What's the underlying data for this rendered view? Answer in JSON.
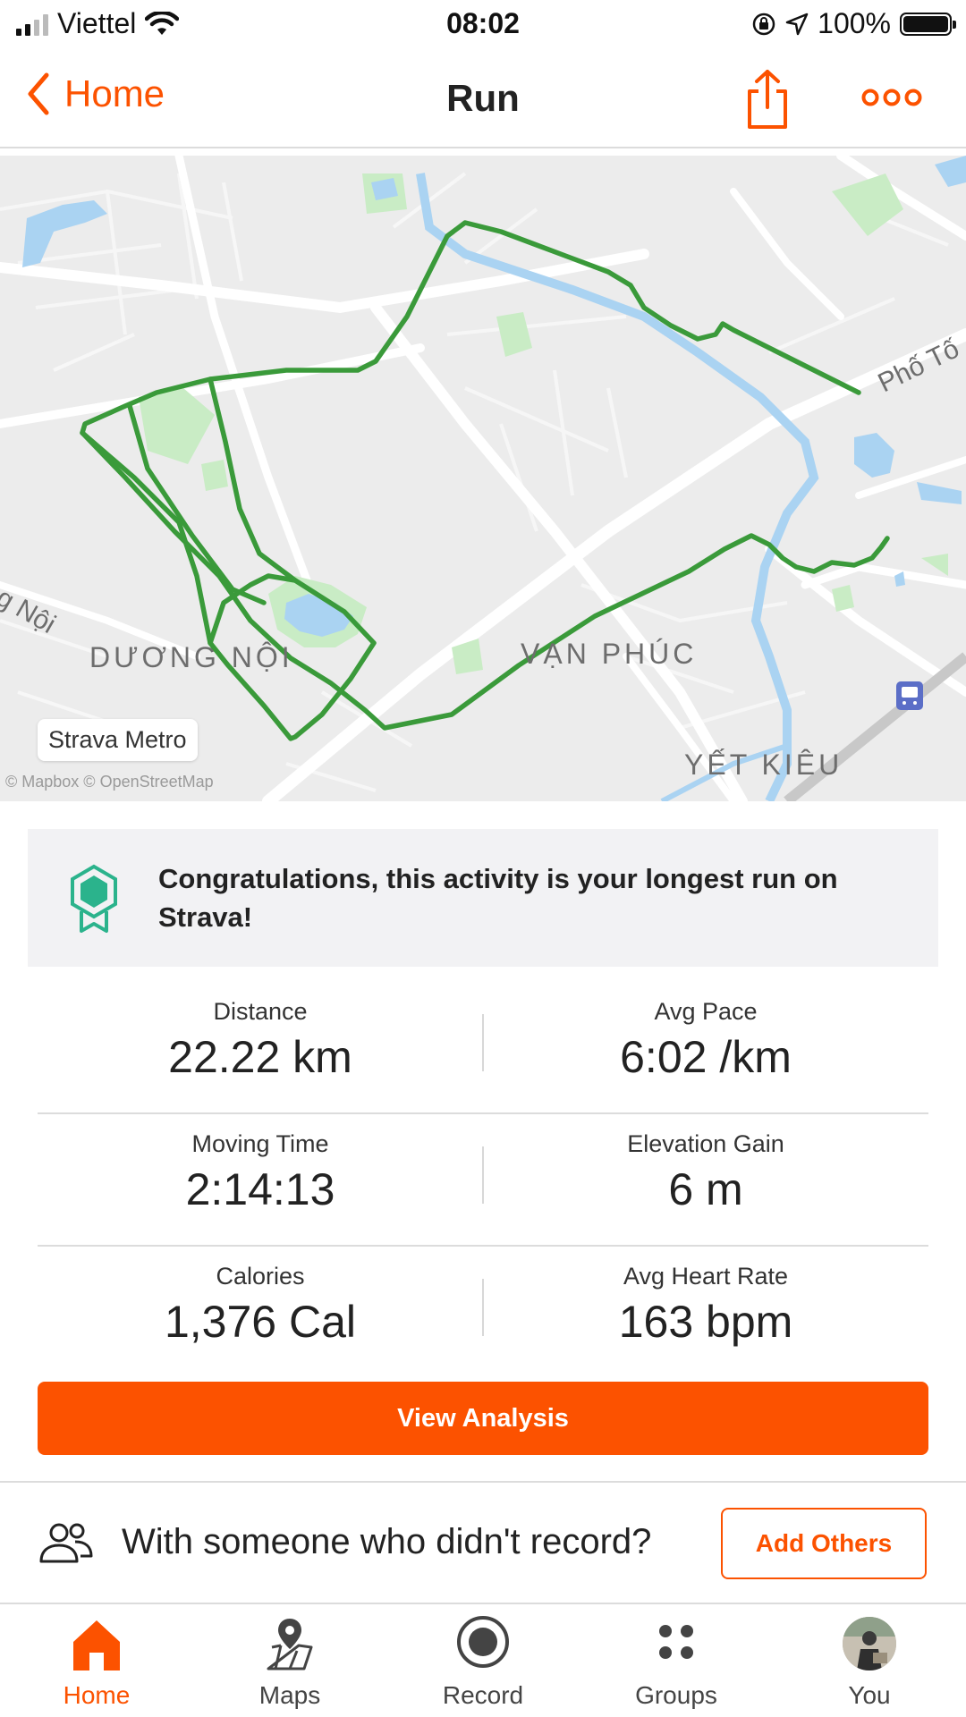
{
  "status_bar": {
    "carrier": "Viettel",
    "time": "08:02",
    "battery": "100%",
    "battery_level": 1.0,
    "icons": [
      "signal-icon",
      "wifi-icon",
      "orientation-lock-icon",
      "location-arrow-icon",
      "battery-icon"
    ]
  },
  "nav": {
    "back_label": "Home",
    "title": "Run",
    "icons": [
      "chevron-left-icon",
      "share-icon",
      "more-icon"
    ]
  },
  "map": {
    "labels": {
      "duong_noi": "DƯƠNG NỘI",
      "van_phuc": "VẠN PHÚC",
      "yet_kieu": "YẾT KIÊU",
      "pho_to": "Phố Tố",
      "g_noi": "g Nội"
    },
    "metro_badge": "Strava Metro",
    "attribution": "© Mapbox © OpenStreetMap",
    "route_color": "#3a9a3a",
    "water_color": "#aad3f2",
    "park_color": "#c9ecc5"
  },
  "banner": {
    "text": "Congratulations, this activity is your longest run on Strava!",
    "icon": "achievement-badge-icon",
    "accent": "#2bb38c"
  },
  "stats": [
    {
      "left": {
        "label": "Distance",
        "value": "22.22 km"
      },
      "right": {
        "label": "Avg Pace",
        "value": "6:02 /km"
      }
    },
    {
      "left": {
        "label": "Moving Time",
        "value": "2:14:13"
      },
      "right": {
        "label": "Elevation Gain",
        "value": "6 m"
      }
    },
    {
      "left": {
        "label": "Calories",
        "value": "1,376 Cal"
      },
      "right": {
        "label": "Avg Heart Rate",
        "value": "163 bpm"
      }
    }
  ],
  "analysis_button": "View Analysis",
  "others": {
    "text": "With someone who didn't record?",
    "button": "Add Others",
    "icon": "people-icon"
  },
  "tabs": [
    {
      "label": "Home",
      "icon": "home-icon",
      "active": true
    },
    {
      "label": "Maps",
      "icon": "maps-icon",
      "active": false
    },
    {
      "label": "Record",
      "icon": "record-icon",
      "active": false
    },
    {
      "label": "Groups",
      "icon": "groups-icon",
      "active": false
    },
    {
      "label": "You",
      "icon": "avatar",
      "active": false
    }
  ],
  "colors": {
    "accent": "#fc5200",
    "text": "#222222",
    "divider": "#dcdcdc"
  }
}
